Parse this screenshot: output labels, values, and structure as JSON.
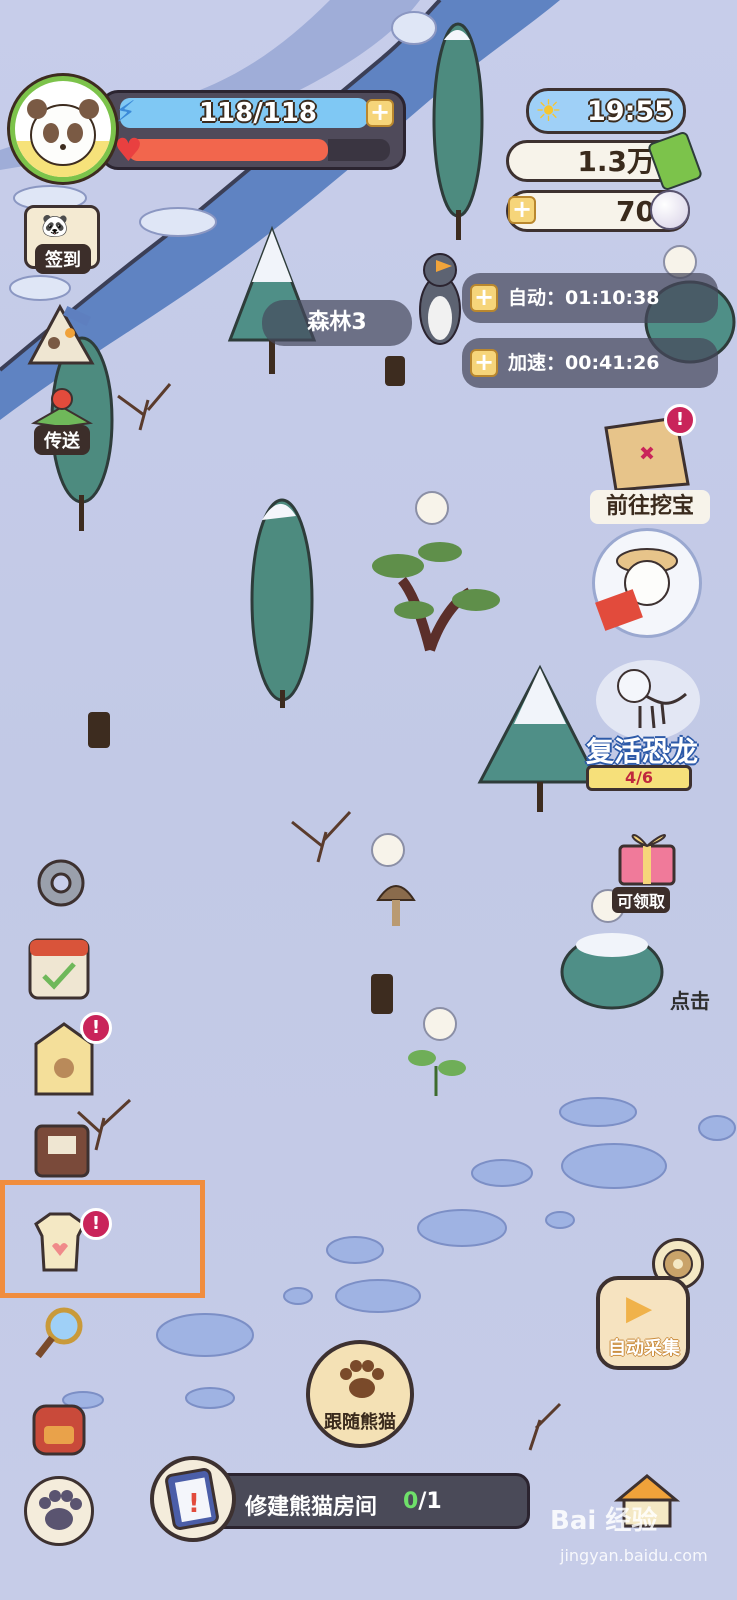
{
  "hud": {
    "energy": "118/118",
    "health_fraction": 0.76,
    "energy_fraction": 1.0,
    "plus": "+"
  },
  "status": {
    "time": "19:55",
    "money": "1.3万",
    "pearls": "70"
  },
  "timers": {
    "auto_label": "自动：01:10:38",
    "boost_label": "加速：00:41:26"
  },
  "area": {
    "name": "森林3"
  },
  "sidebar": {
    "checkin_label": "签到",
    "teleport_label": "传送",
    "badge": "!"
  },
  "right_panel": {
    "dig_label": "前往挖宝",
    "revive_label": "复活恐龙",
    "revive_progress": "4/6",
    "claim_label": "可领取",
    "tap_hint": "点击"
  },
  "bottom": {
    "follow_label": "跟随熊猫",
    "auto_collect_label": "自动采集",
    "task_label": "修建熊猫房间",
    "task_done": "0",
    "task_total": "/1"
  },
  "watermark": {
    "main": "Bai 经验",
    "sub": "jingyan.baidu.com"
  },
  "colors": {
    "ground": "#c7cdea",
    "river": "#5f83c2",
    "tree": "#4d8b7f",
    "highlight": "#f08d3e",
    "badge": "#c9245a"
  }
}
